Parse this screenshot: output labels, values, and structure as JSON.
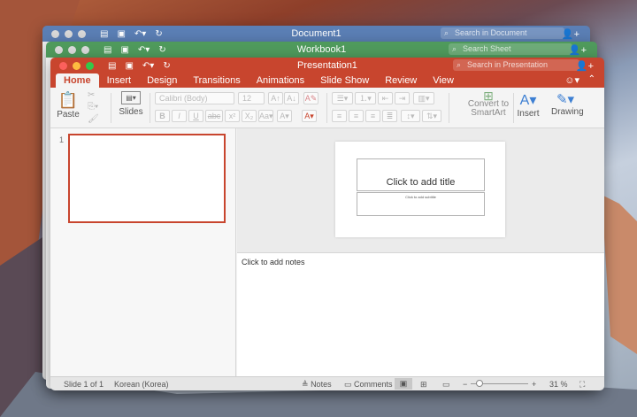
{
  "word": {
    "title": "Document1",
    "search_placeholder": "Search in Document",
    "color": "#5b7fb5"
  },
  "excel": {
    "title": "Workbook1",
    "search_placeholder": "Search Sheet",
    "color": "#4f9a5c"
  },
  "ppt": {
    "title": "Presentation1",
    "search_placeholder": "Search in Presentation",
    "color": "#c8452e",
    "tabs": [
      "Home",
      "Insert",
      "Design",
      "Transitions",
      "Animations",
      "Slide Show",
      "Review",
      "View"
    ],
    "ribbon": {
      "paste": "Paste",
      "slides": "Slides",
      "font": "Calibri (Body)",
      "size": "12",
      "bold": "B",
      "italic": "I",
      "underline": "U",
      "strike": "abc",
      "superscript": "x²",
      "subscript": "X₂",
      "convert_line1": "Convert to",
      "convert_line2": "SmartArt",
      "insert": "Insert",
      "drawing": "Drawing"
    },
    "thumbnail_number": "1",
    "slide": {
      "title_placeholder": "Click to add title",
      "subtitle_placeholder": "Click to add subtitle"
    },
    "notes_placeholder": "Click to add notes",
    "status": {
      "slide_info": "Slide 1 of 1",
      "language": "Korean (Korea)",
      "notes": "Notes",
      "comments": "Comments",
      "zoom": "31 %"
    }
  },
  "colors": {
    "close": "#fc605c",
    "minimize": "#fdbc40",
    "zoom": "#34c84a"
  }
}
